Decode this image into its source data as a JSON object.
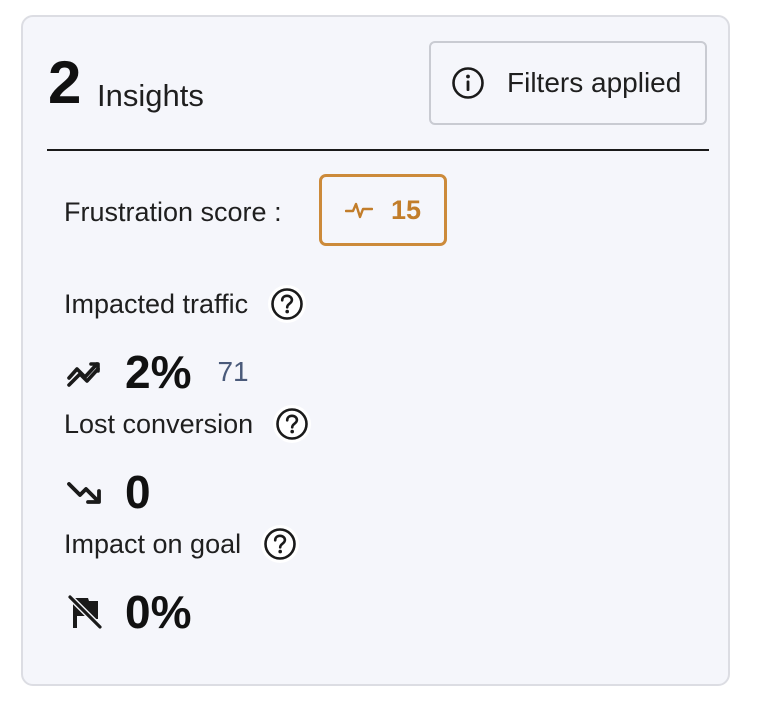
{
  "header": {
    "count": "2",
    "count_label": "Insights",
    "filters_label": "Filters applied"
  },
  "frustration": {
    "label": "Frustration score :",
    "value": "15",
    "color": "#c27d2a"
  },
  "metrics": [
    {
      "label": "Impacted traffic",
      "icon": "traffic-trend-icon",
      "value": "2%",
      "sub": "71"
    },
    {
      "label": "Lost conversion",
      "icon": "trend-down-icon",
      "value": "0",
      "sub": ""
    },
    {
      "label": "Impact on goal",
      "icon": "flag-off-icon",
      "value": "0%",
      "sub": ""
    }
  ]
}
